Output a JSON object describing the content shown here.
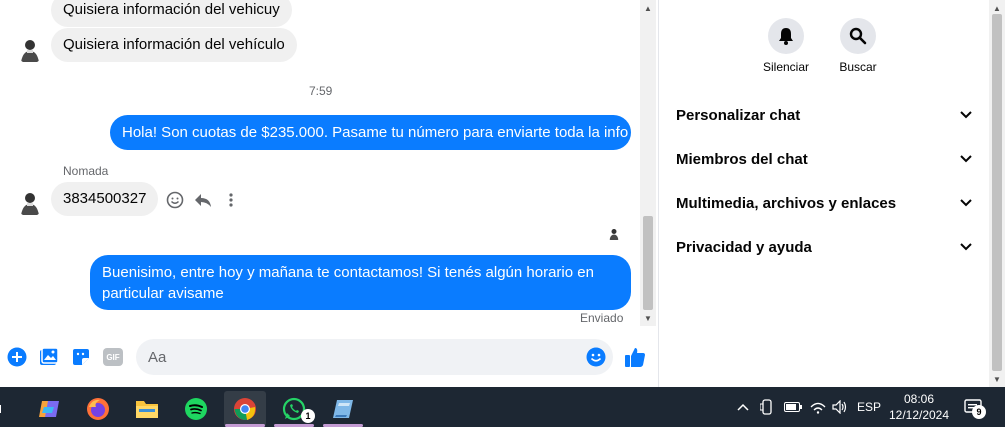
{
  "chat": {
    "messages": {
      "m1": "Quisiera información del vehicuy",
      "m2": "Quisiera información del vehículo",
      "time1": "7:59",
      "m3": "Hola! Son cuotas de $235.000. Pasame tu número para enviarte toda la info",
      "sender": "Nomada",
      "m4": "3834500327",
      "m5": "Buenisimo, entre hoy y mañana te contactamos! Si tenés algún horario en particular avisame",
      "status": "Enviado"
    },
    "composer": {
      "placeholder": "Aa",
      "gif_label": "GIF"
    }
  },
  "details": {
    "actions": {
      "mute": "Silenciar",
      "search": "Buscar"
    },
    "sections": {
      "customize": "Personalizar chat",
      "members": "Miembros del chat",
      "media": "Multimedia, archivos y enlaces",
      "privacy": "Privacidad y ayuda"
    }
  },
  "taskbar": {
    "lang": "ESP",
    "time": "08:06",
    "date": "12/12/2024",
    "whatsapp_badge": "1",
    "notif_badge": "9"
  },
  "colors": {
    "accent": "#0a7cff",
    "taskbar": "#1d2733"
  }
}
